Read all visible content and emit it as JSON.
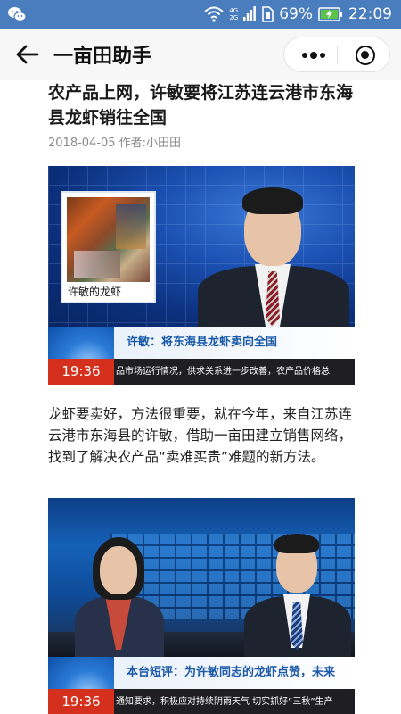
{
  "status_bar": {
    "network": "4G",
    "network2": "2G",
    "battery": "69%",
    "time": "22:09"
  },
  "nav": {
    "title": "一亩田助手"
  },
  "article": {
    "title": "农产品上网，许敏要将江苏连云港市东海县龙虾销往全国",
    "meta": "2018-04-05 作者:小田田",
    "paragraph": "龙虾要卖好，方法很重要，就在今年，来自江苏连云港市东海县的许敏，借助一亩田建立销售网络，找到了解决农产品“卖难买贵”难题的新方法。"
  },
  "image1": {
    "inset_caption": "许敏的龙虾",
    "headline": "许敏：将东海县龙虾卖向全国",
    "time": "19:36",
    "crawl": "品市场运行情况，供求关系进一步改善，农产品价格总"
  },
  "image2": {
    "headline": "本台短评：为许敏同志的龙虾点赞，未来",
    "time": "19:36",
    "crawl": "通知要求，积极应对持续阴雨天气 切实抓好“三秋”生产"
  },
  "colors": {
    "status_bar": "#4a7dbd",
    "ticker_red": "#d5301d",
    "headline_blue": "#1657a8"
  }
}
